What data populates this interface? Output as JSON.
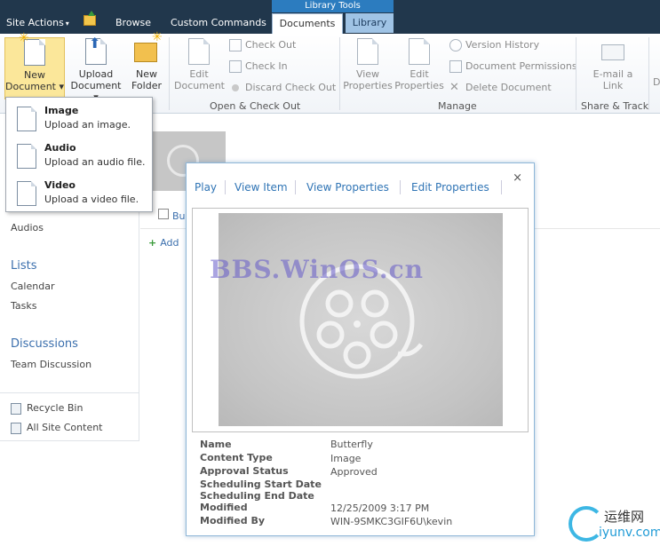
{
  "topbar": {
    "site_actions": "Site Actions",
    "site_actions_arrow": "▾",
    "browse": "Browse",
    "custom_commands": "Custom Commands",
    "library_tools": "Library Tools",
    "tab_documents": "Documents",
    "tab_library": "Library"
  },
  "ribbon": {
    "new_document": [
      "New",
      "Document ▾"
    ],
    "upload_document": [
      "Upload",
      "Document ▾"
    ],
    "new_folder": [
      "New",
      "Folder"
    ],
    "edit_document": [
      "Edit",
      "Document"
    ],
    "check_out": "Check Out",
    "check_in": "Check In",
    "discard_check_out": "Discard Check Out",
    "group_open_check": "Open & Check Out",
    "view_properties": [
      "View",
      "Properties"
    ],
    "edit_properties": [
      "Edit",
      "Properties"
    ],
    "version_history": "Version History",
    "document_permissions": "Document Permissions",
    "delete_document": "Delete Document",
    "group_manage": "Manage",
    "email_link": [
      "E-mail a",
      "Link"
    ],
    "group_share": "Share & Track",
    "cut_letter": "D"
  },
  "new_doc_menu": [
    {
      "title": "Image",
      "desc": "Upload an image."
    },
    {
      "title": "Audio",
      "desc": "Upload an audio file."
    },
    {
      "title": "Video",
      "desc": "Upload a video file."
    }
  ],
  "leftnav": {
    "audios": "Audios",
    "lists_head": "Lists",
    "calendar": "Calendar",
    "tasks": "Tasks",
    "discussions_head": "Discussions",
    "team_discussion": "Team Discussion",
    "recycle_bin": "Recycle Bin",
    "all_site_content": "All Site Content"
  },
  "main": {
    "item_name_partial": "Bu",
    "add_partial": "Add"
  },
  "callout": {
    "close": "×",
    "actions": [
      "Play",
      "View Item",
      "View Properties",
      "Edit Properties"
    ],
    "watermark": "BBS.WinOS.cn",
    "meta": [
      {
        "label": "Name",
        "value": "Butterfly"
      },
      {
        "label": "Content Type",
        "value": "Image"
      },
      {
        "label": "Approval Status",
        "value": "Approved"
      },
      {
        "label": "Scheduling Start Date",
        "value": ""
      },
      {
        "label": "Scheduling End Date",
        "value": ""
      },
      {
        "label": "Modified",
        "value": "12/25/2009 3:17 PM"
      },
      {
        "label": "Modified By",
        "value": "WIN-9SMKC3GIF6U\\kevin"
      }
    ]
  },
  "logo": {
    "cn": "运维网",
    "url": "iyunv.com"
  }
}
